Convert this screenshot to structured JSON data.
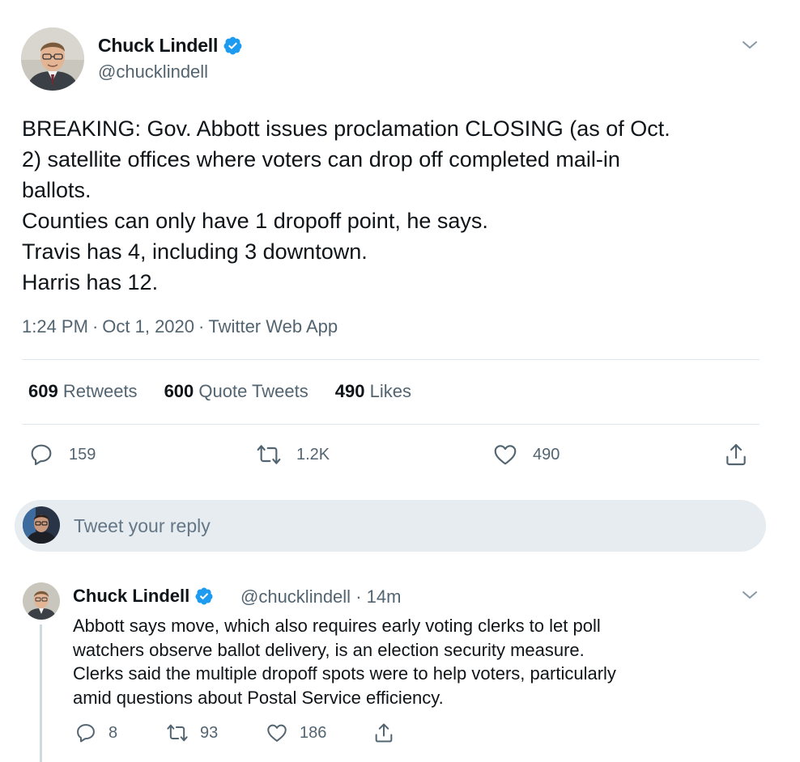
{
  "tweet": {
    "author_name": "Chuck Lindell",
    "author_handle": "@chucklindell",
    "text_lines": [
      "BREAKING: Gov. Abbott issues proclamation CLOSING (as of Oct.",
      "2) satellite offices where voters can drop off completed mail-in",
      "ballots.",
      "Counties can only have 1 dropoff point, he says.",
      "Travis has 4, including 3 downtown.",
      "Harris has 12."
    ],
    "time": "1:24 PM",
    "date": "Oct 1, 2020",
    "source": "Twitter Web App",
    "stats": {
      "retweets_count": "609",
      "retweets_label": "Retweets",
      "quotes_count": "600",
      "quotes_label": "Quote Tweets",
      "likes_count": "490",
      "likes_label": "Likes"
    },
    "actions": {
      "reply_count": "159",
      "retweet_count": "1.2K",
      "like_count": "490"
    },
    "icons": [
      "verified-badge-icon",
      "chevron-down-icon",
      "reply-icon",
      "retweet-icon",
      "like-icon",
      "share-icon"
    ]
  },
  "reply_composer": {
    "placeholder": "Tweet your reply"
  },
  "reply_tweet": {
    "author_name": "Chuck Lindell",
    "author_handle": "@chucklindell",
    "separator": "·",
    "age": "14m",
    "text_lines": [
      "Abbott says move, which also requires early voting clerks to let poll",
      "watchers observe ballot delivery, is an election security measure.",
      "Clerks said the multiple dropoff spots were to help voters, particularly",
      "amid questions about Postal Service efficiency."
    ],
    "actions": {
      "reply_count": "8",
      "retweet_count": "93",
      "like_count": "186"
    }
  },
  "colors": {
    "accent": "#1d9bf0",
    "text_primary": "#0f1419",
    "text_secondary": "#536471",
    "divider": "#e1e8ed",
    "reply_box_bg": "#e6ecf0"
  }
}
